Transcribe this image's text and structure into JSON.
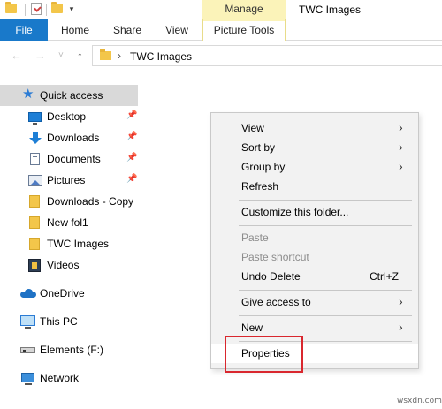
{
  "title_bar": {
    "contextual_tab_group": "Manage",
    "window_title": "TWC Images",
    "qat_dropdown_glyph": "▾"
  },
  "ribbon": {
    "tabs": [
      {
        "label": "File",
        "active": true
      },
      {
        "label": "Home"
      },
      {
        "label": "Share"
      },
      {
        "label": "View"
      },
      {
        "label": "Picture Tools"
      }
    ]
  },
  "navigation": {
    "back_icon": "back-arrow-icon",
    "forward_icon": "forward-arrow-icon",
    "recent_icon": "chevron-down-icon",
    "up_icon": "up-arrow-icon",
    "back_glyph": "←",
    "forward_glyph": "→",
    "recent_glyph": "˅",
    "up_glyph": "↑",
    "breadcrumb_separator": "›",
    "breadcrumb": "TWC Images"
  },
  "sidebar": {
    "items": [
      {
        "label": "Quick access",
        "icon": "star-icon",
        "selected": true
      },
      {
        "label": "Desktop",
        "icon": "desktop-icon",
        "pinned": true
      },
      {
        "label": "Downloads",
        "icon": "download-icon",
        "pinned": true
      },
      {
        "label": "Documents",
        "icon": "documents-icon",
        "pinned": true
      },
      {
        "label": "Pictures",
        "icon": "pictures-icon",
        "pinned": true
      },
      {
        "label": "Downloads - Copy",
        "icon": "folder-icon"
      },
      {
        "label": "New fol1",
        "icon": "folder-icon"
      },
      {
        "label": "TWC Images",
        "icon": "folder-icon"
      },
      {
        "label": "Videos",
        "icon": "videos-icon"
      },
      {
        "label": "OneDrive",
        "icon": "onedrive-icon"
      },
      {
        "label": "This PC",
        "icon": "computer-icon"
      },
      {
        "label": "Elements (F:)",
        "icon": "drive-icon"
      },
      {
        "label": "Network",
        "icon": "network-icon"
      }
    ],
    "pin_glyph": "📌",
    "star_glyph": "★"
  },
  "context_menu": {
    "submenu_glyph": "›",
    "items": [
      {
        "label": "View",
        "submenu": true
      },
      {
        "label": "Sort by",
        "submenu": true
      },
      {
        "label": "Group by",
        "submenu": true
      },
      {
        "label": "Refresh"
      },
      {
        "label": "Customize this folder..."
      },
      {
        "label": "Paste",
        "disabled": true
      },
      {
        "label": "Paste shortcut",
        "disabled": true
      },
      {
        "label": "Undo Delete",
        "shortcut": "Ctrl+Z"
      },
      {
        "label": "Give access to",
        "submenu": true
      },
      {
        "label": "New",
        "submenu": true
      },
      {
        "label": "Properties",
        "highlighted": true
      }
    ]
  },
  "watermark": "wsxdn.com",
  "colors": {
    "file_tab": "#1979ca",
    "manage_tab": "#fbf3b9",
    "highlight_box": "#d9272e",
    "selected_nav": "#d9d9d9"
  }
}
